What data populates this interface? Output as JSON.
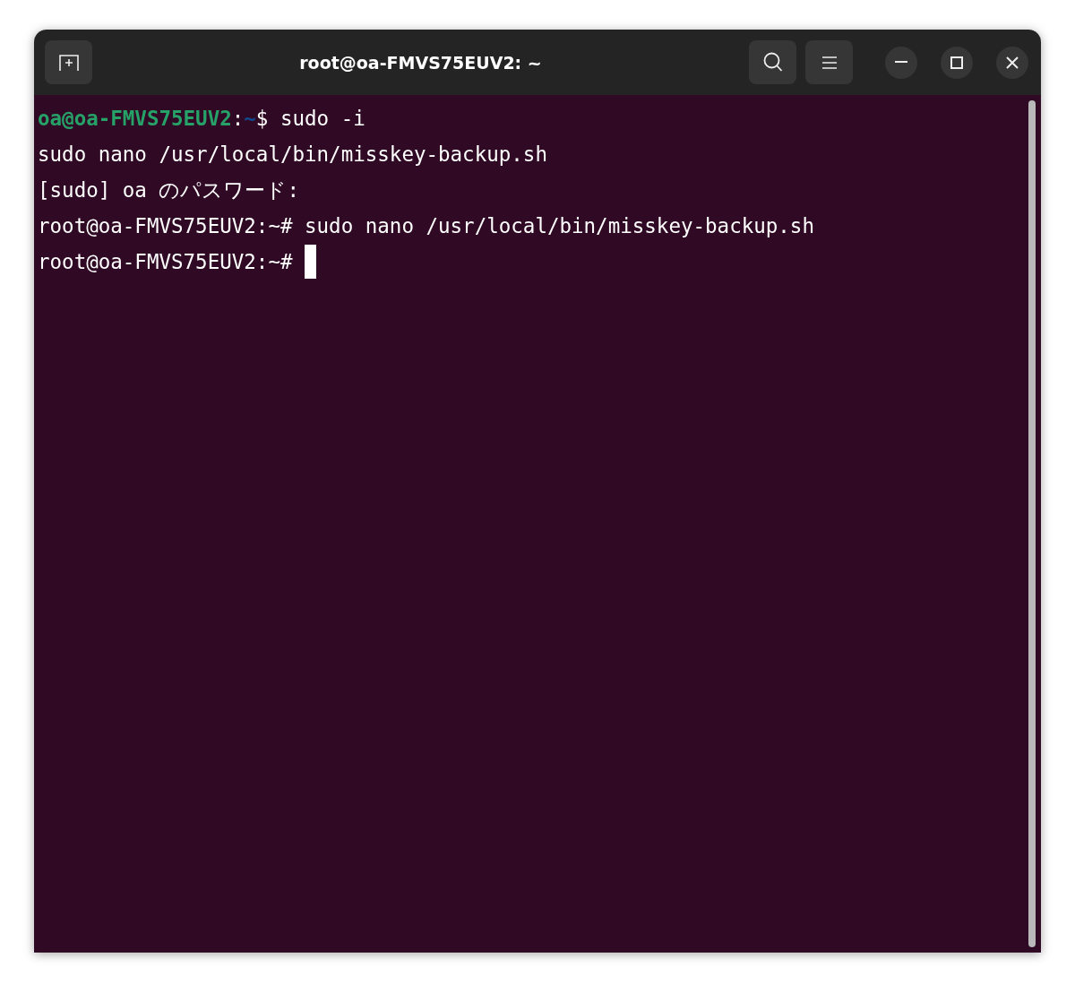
{
  "window": {
    "title": "root@oa-FMVS75EUV2: ~"
  },
  "terminal": {
    "lines": [
      {
        "segments": [
          {
            "kind": "user",
            "text": "oa@oa-FMVS75EUV2"
          },
          {
            "kind": "plain",
            "text": ":"
          },
          {
            "kind": "path",
            "text": "~"
          },
          {
            "kind": "plain",
            "text": "$ sudo -i"
          }
        ]
      },
      {
        "segments": [
          {
            "kind": "plain",
            "text": "sudo nano /usr/local/bin/misskey-backup.sh"
          }
        ]
      },
      {
        "segments": [
          {
            "kind": "plain",
            "text": "[sudo] oa のパスワード:"
          }
        ]
      },
      {
        "segments": [
          {
            "kind": "plain",
            "text": "root@oa-FMVS75EUV2:~# sudo nano /usr/local/bin/misskey-backup.sh"
          }
        ]
      },
      {
        "segments": [
          {
            "kind": "plain",
            "text": "root@oa-FMVS75EUV2:~# "
          }
        ],
        "cursor": true
      }
    ]
  }
}
